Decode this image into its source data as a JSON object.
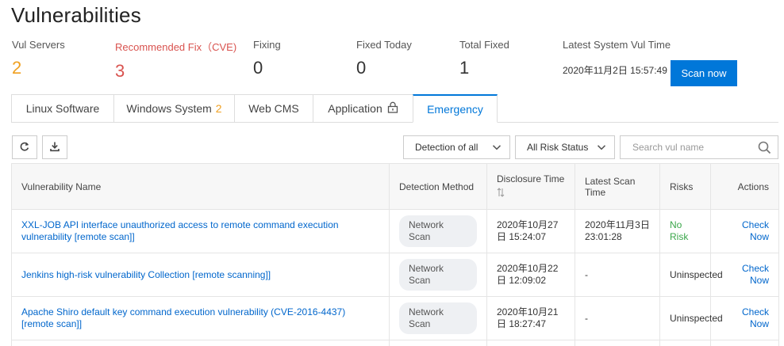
{
  "page": {
    "title": "Vulnerabilities"
  },
  "stats": {
    "vul_servers": {
      "label": "Vul Servers",
      "value": "2"
    },
    "recommended_fix": {
      "label": "Recommended Fix（CVE)",
      "value": "3"
    },
    "fixing": {
      "label": "Fixing",
      "value": "0"
    },
    "fixed_today": {
      "label": "Fixed Today",
      "value": "0"
    },
    "total_fixed": {
      "label": "Total Fixed",
      "value": "1"
    },
    "latest_time": {
      "label": "Latest System Vul Time",
      "value": "2020年11月2日 15:57:49"
    }
  },
  "scan_button": {
    "label": "Scan now"
  },
  "tabs": [
    {
      "label": "Linux Software",
      "badge": ""
    },
    {
      "label": "Windows System",
      "badge": "2"
    },
    {
      "label": "Web CMS",
      "badge": ""
    },
    {
      "label": "Application",
      "badge": "",
      "icon": "lock-icon"
    },
    {
      "label": "Emergency",
      "badge": "",
      "active": true
    }
  ],
  "toolbar": {
    "refresh_icon": "refresh-icon",
    "download_icon": "download-icon",
    "detection_filter": "Detection of all",
    "risk_filter": "All Risk Status",
    "search_placeholder": "Search vul name"
  },
  "table": {
    "headers": {
      "name": "Vulnerability Name",
      "method": "Detection Method",
      "disclosure": "Disclosure Time",
      "latest_scan": "Latest Scan Time",
      "risks": "Risks",
      "actions": "Actions"
    },
    "rows": [
      {
        "name": "XXL-JOB API interface unauthorized access to remote command execution vulnerability [remote scan]]",
        "method": "Network Scan",
        "disclosure": "2020年10月27日 15:24:07",
        "latest_scan": "2020年11月3日 23:01:28",
        "risk": "No Risk",
        "action": "Check Now"
      },
      {
        "name": "Jenkins high-risk vulnerability Collection [remote scanning]]",
        "method": "Network Scan",
        "disclosure": "2020年10月22日 12:09:02",
        "latest_scan": "-",
        "risk": "Uninspected",
        "action": "Check Now"
      },
      {
        "name": "Apache Shiro default key command execution vulnerability (CVE-2016-4437) [remote scan]]",
        "method": "Network Scan",
        "disclosure": "2020年10月21日 18:27:47",
        "latest_scan": "-",
        "risk": "Uninspected",
        "action": "Check Now"
      }
    ]
  },
  "colors": {
    "accent": "#0077d9",
    "warning": "#f0a020",
    "danger": "#d9534f",
    "success": "#3aa64a",
    "link": "#0066cc"
  }
}
